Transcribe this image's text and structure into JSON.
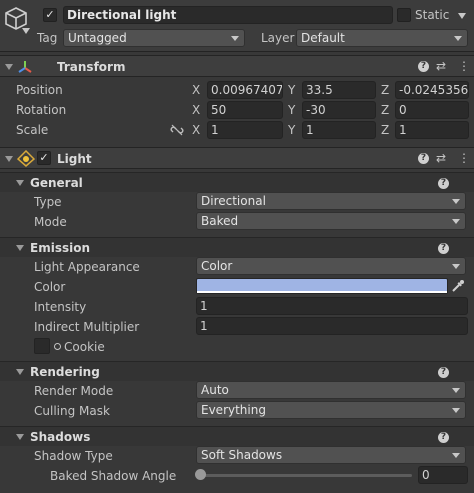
{
  "object": {
    "name": "Directional light",
    "active_checked": "✓",
    "static_label": "Static",
    "tag_label": "Tag",
    "tag_value": "Untagged",
    "layer_label": "Layer",
    "layer_value": "Default"
  },
  "transform": {
    "title": "Transform",
    "rows": [
      {
        "label": "Position",
        "x": "0.00967407",
        "y": "33.5",
        "z": "-0.0245356"
      },
      {
        "label": "Rotation",
        "x": "50",
        "y": "-30",
        "z": "0"
      },
      {
        "label": "Scale",
        "x": "1",
        "y": "1",
        "z": "1"
      }
    ],
    "axes": {
      "x": "X",
      "y": "Y",
      "z": "Z"
    }
  },
  "light": {
    "title": "Light",
    "enabled_checked": "✓",
    "general": {
      "title": "General",
      "type_label": "Type",
      "type_value": "Directional",
      "mode_label": "Mode",
      "mode_value": "Baked"
    },
    "emission": {
      "title": "Emission",
      "appearance_label": "Light Appearance",
      "appearance_value": "Color",
      "color_label": "Color",
      "color_value": "#9fb4e4",
      "intensity_label": "Intensity",
      "intensity_value": "1",
      "indirect_label": "Indirect Multiplier",
      "indirect_value": "1",
      "cookie_label": "Cookie"
    },
    "rendering": {
      "title": "Rendering",
      "render_mode_label": "Render Mode",
      "render_mode_value": "Auto",
      "culling_label": "Culling Mask",
      "culling_value": "Everything"
    },
    "shadows": {
      "title": "Shadows",
      "type_label": "Shadow Type",
      "type_value": "Soft Shadows",
      "angle_label": "Baked Shadow Angle",
      "angle_value": "0"
    }
  },
  "help_glyph": "?"
}
